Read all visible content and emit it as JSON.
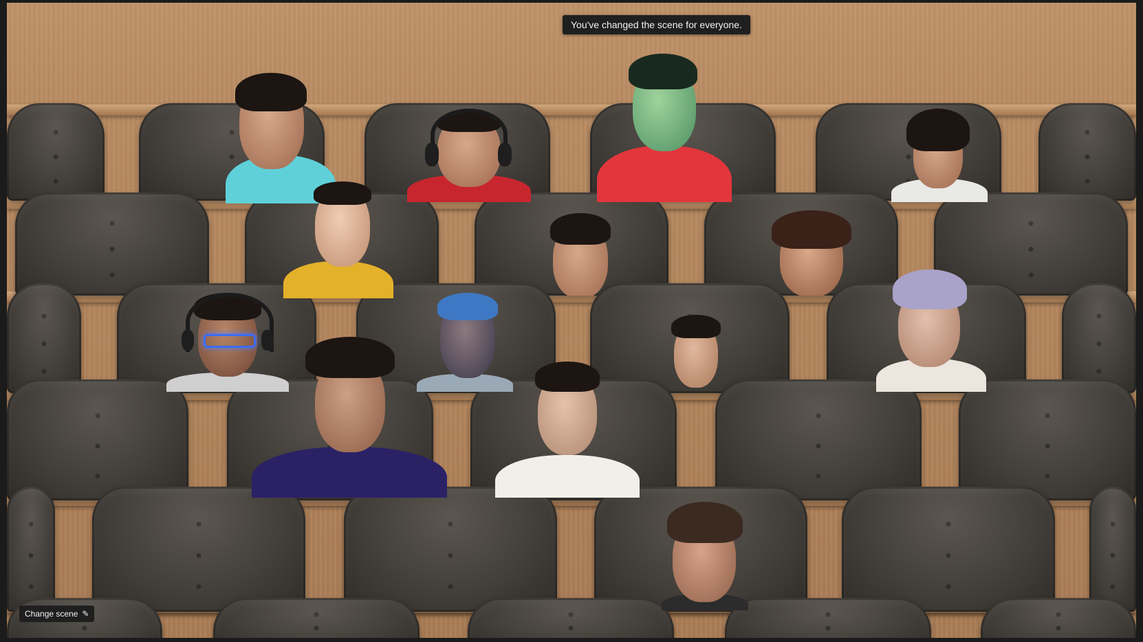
{
  "scene": {
    "notification": "You've changed the scene for everyone.",
    "change_scene_label": "Change scene",
    "change_scene_icon": "pencil-icon"
  },
  "colors": {
    "wall": "#b98c63",
    "seat": "#433f3a",
    "toast_bg": "#1f1f1f",
    "toast_text": "#f2f2f2"
  },
  "participants_visible": 16
}
